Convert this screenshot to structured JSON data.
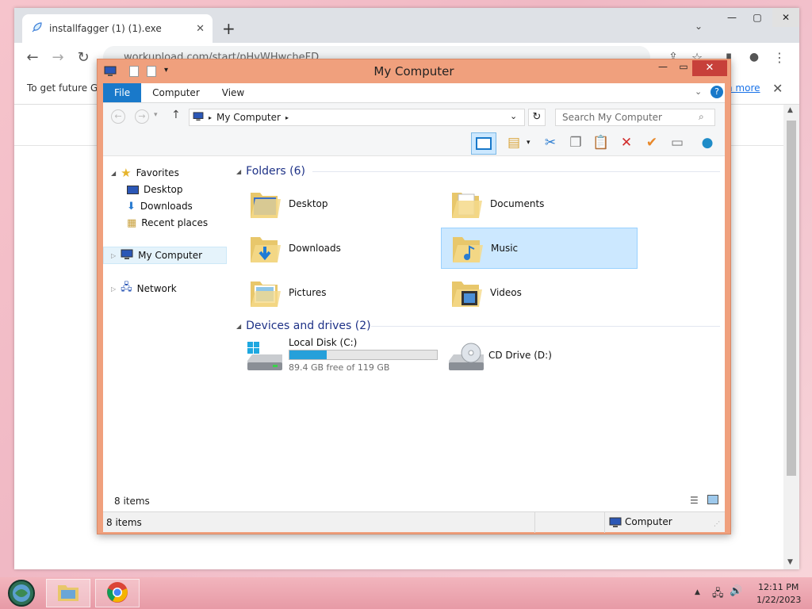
{
  "browser": {
    "tab_title": "installfagger (1) (1).exe",
    "url": "workupload.com/start/pHvWHwcheFD",
    "info_text": "To get future G",
    "learn_more": "n more",
    "new_tab": "+",
    "icons": [
      "rocket-icon",
      "close-icon",
      "plus-icon",
      "chevron-down-icon",
      "minimize-icon",
      "maximize-icon",
      "close-icon",
      "back-icon",
      "forward-icon",
      "reload-icon",
      "share-icon",
      "star-icon",
      "sidebar-icon",
      "profile-icon",
      "menu-icon"
    ]
  },
  "explorer": {
    "title": "My Computer",
    "ribbon_tabs": [
      "File",
      "Computer",
      "View"
    ],
    "address": "My Computer",
    "search_placeholder": "Search My Computer",
    "nav": {
      "favorites": "Favorites",
      "fav_items": [
        "Desktop",
        "Downloads",
        "Recent places"
      ],
      "computer": "My Computer",
      "network": "Network"
    },
    "folders_header": "Folders (6)",
    "folders": [
      "Desktop",
      "Documents",
      "Downloads",
      "Music",
      "Pictures",
      "Videos"
    ],
    "selected_folder": "Music",
    "drives_header": "Devices and drives (2)",
    "drives": [
      {
        "name": "Local Disk (C:)",
        "free_text": "89.4 GB free of 119 GB",
        "used_fraction": 0.25
      },
      {
        "name": "CD Drive (D:)"
      }
    ],
    "content_items": "8 items",
    "status_items": "8 items",
    "status_location": "Computer"
  },
  "taskbar": {
    "time": "12:11 PM",
    "date": "1/22/2023",
    "apps": [
      "start-orb",
      "file-explorer",
      "chrome"
    ]
  },
  "colors": {
    "accent": "#1979ca",
    "window_frame": "#f0a07d",
    "group_header": "#1e3287",
    "selection": "#cce8ff",
    "drive_bar": "#26a0da"
  }
}
